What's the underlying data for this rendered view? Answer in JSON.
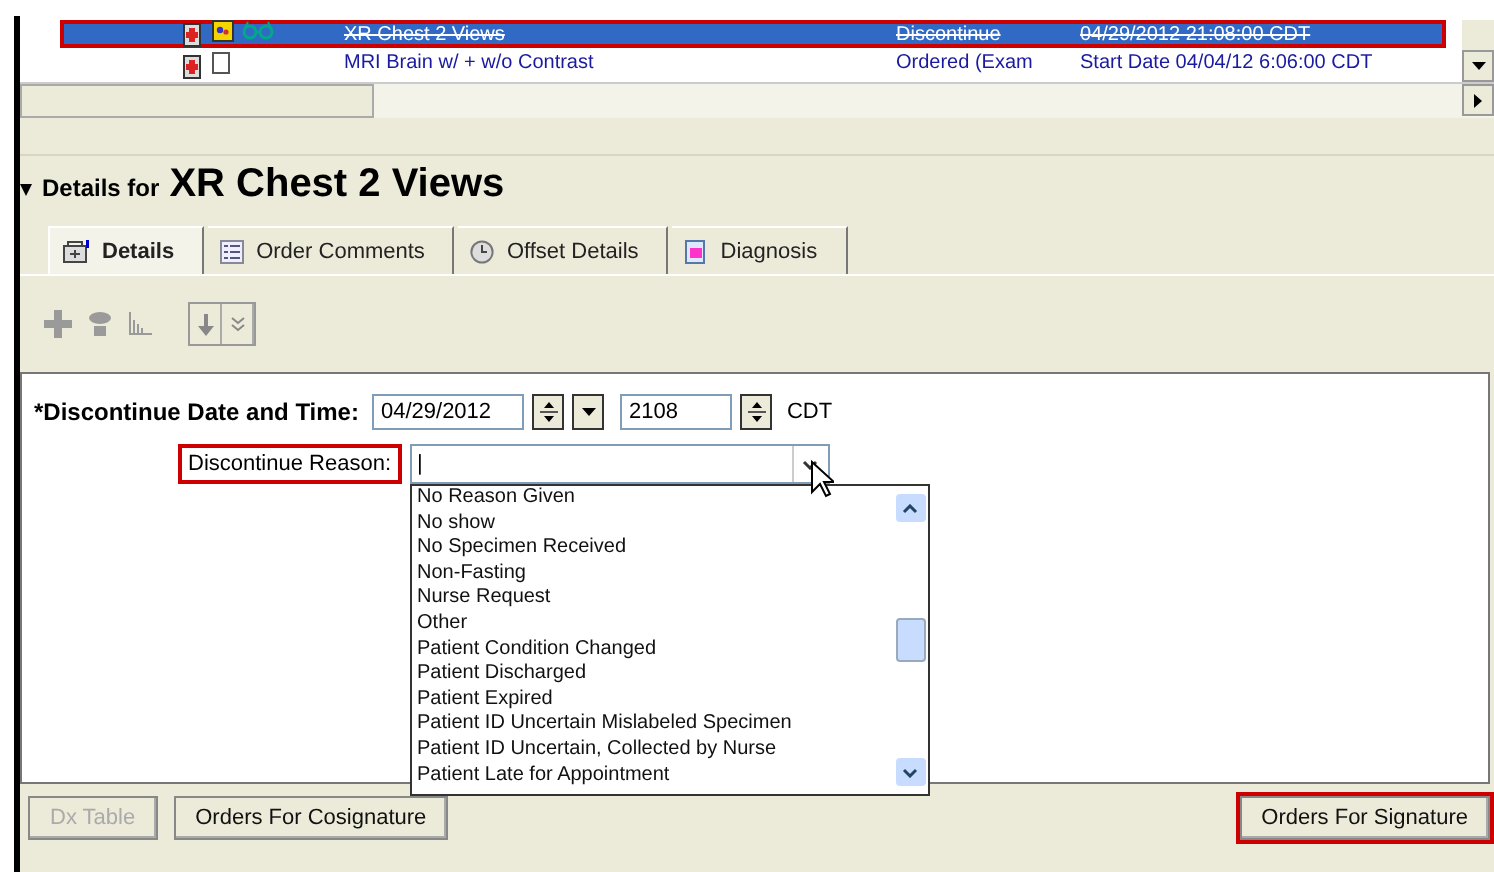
{
  "orders": [
    {
      "name": "XR Chest 2 Views",
      "status": "Discontinue",
      "date": "04/29/2012 21:08:00 CDT",
      "selected": true,
      "discontinued": true,
      "highlighted": true,
      "kind": "full"
    },
    {
      "name": "MRI Brain w/ + w/o Contrast",
      "status": "Ordered (Exam",
      "date": "Start Date 04/04/12 6:06:00 CDT",
      "selected": false,
      "discontinued": false,
      "highlighted": false,
      "kind": "simple"
    }
  ],
  "details": {
    "prefix": "Details for",
    "title": "XR Chest 2 Views"
  },
  "tabs": [
    {
      "label": "Details",
      "selected": true
    },
    {
      "label": "Order Comments",
      "selected": false
    },
    {
      "label": "Offset Details",
      "selected": false
    },
    {
      "label": "Diagnosis",
      "selected": false
    }
  ],
  "form": {
    "date_label": "*Discontinue Date and Time:",
    "date": "04/29/2012",
    "time": "2108",
    "zone": "CDT",
    "reason_label": "Discontinue Reason:",
    "reason_highlighted": true,
    "reason_value": "|",
    "options": [
      "No Reason Given",
      "No show",
      "No Specimen Received",
      "Non-Fasting",
      "Nurse Request",
      "Other",
      "Patient Condition Changed",
      "Patient Discharged",
      "Patient Expired",
      "Patient ID Uncertain Mislabeled Specimen",
      "Patient ID Uncertain, Collected by Nurse",
      "Patient Late for Appointment"
    ]
  },
  "buttons": [
    {
      "label": "Dx Table",
      "disabled": true,
      "highlighted": false
    },
    {
      "label": "Orders For Cosignature",
      "disabled": false,
      "highlighted": false
    },
    {
      "label": "Orders For Signature",
      "disabled": false,
      "highlighted": true
    }
  ]
}
